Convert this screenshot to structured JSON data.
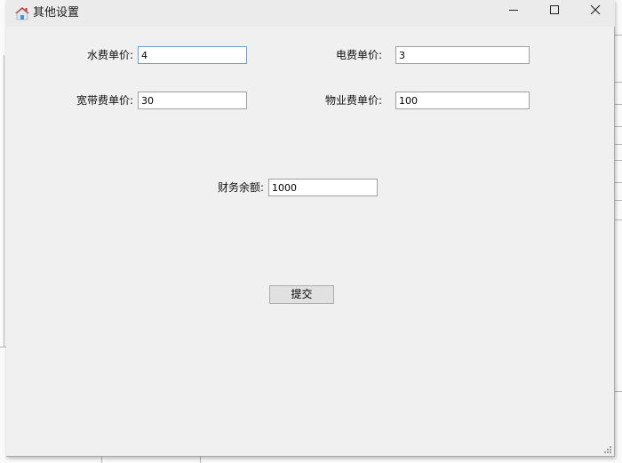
{
  "window": {
    "title": "其他设置",
    "icon": "home-icon",
    "controls": {
      "minimize": "minimize-icon",
      "maximize": "maximize-icon",
      "close": "close-icon"
    }
  },
  "form": {
    "water_price": {
      "label": "水费单价:",
      "value": "4"
    },
    "electricity_price": {
      "label": "电费单价:",
      "value": "3"
    },
    "broadband_price": {
      "label": "宽带费单价:",
      "value": "30"
    },
    "property_price": {
      "label": "物业费单价:",
      "value": "100"
    },
    "finance_balance": {
      "label": "财务余额:",
      "value": "1000"
    },
    "submit_label": "提交"
  },
  "colors": {
    "window_bg": "#f0f0f0",
    "titlebar_bg": "#ebebeb",
    "focus_border": "#6a9ed0",
    "input_border": "#a0a0a0",
    "button_bg": "#e1e1e1"
  }
}
